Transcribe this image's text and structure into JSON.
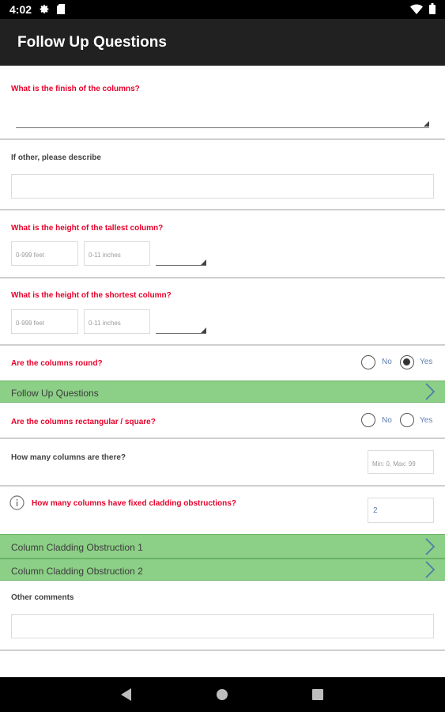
{
  "status_bar": {
    "time": "4:02"
  },
  "app_bar": {
    "title": "Follow Up Questions"
  },
  "questions": {
    "finish": {
      "label": "What is the finish of the columns?"
    },
    "other_describe": {
      "label": "If other, please describe"
    },
    "tallest": {
      "label": "What is the height of the tallest column?",
      "feet_placeholder": "0-999 feet",
      "inches_placeholder": "0-11 inches"
    },
    "shortest": {
      "label": "What is the height of the shortest column?",
      "feet_placeholder": "0-999 feet",
      "inches_placeholder": "0-11 inches"
    },
    "round": {
      "label": "Are the columns round?",
      "no_label": "No",
      "yes_label": "Yes",
      "selected": "Yes"
    },
    "rectangular": {
      "label": "Are the columns rectangular / square?",
      "no_label": "No",
      "yes_label": "Yes",
      "selected": ""
    },
    "count": {
      "label": "How many columns are there?",
      "placeholder": "Min: 0, Max: 99"
    },
    "fixed_cladding": {
      "label": "How many columns have fixed cladding obstructions?",
      "value": "2"
    },
    "other_comments": {
      "label": "Other comments"
    }
  },
  "sections": {
    "follow_up": {
      "label": "Follow Up Questions"
    },
    "obstruction_1": {
      "label": "Column Cladding Obstruction 1"
    },
    "obstruction_2": {
      "label": "Column Cladding Obstruction 2"
    }
  },
  "colors": {
    "question_red": "#e8002a",
    "section_green": "#8ccf86",
    "app_bar": "#212121",
    "radio_label_blue": "#5f7fae"
  },
  "icons": [
    "gear-icon",
    "sd-card-icon",
    "wifi-icon",
    "battery-icon",
    "chevron-right-icon",
    "info-icon",
    "back-icon",
    "home-icon",
    "recents-icon"
  ]
}
